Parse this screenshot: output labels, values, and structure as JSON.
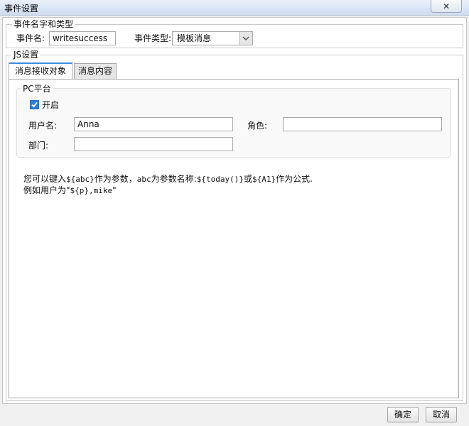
{
  "window": {
    "title": "事件设置",
    "close_glyph": "✕"
  },
  "event_group": {
    "legend": "事件名字和类型",
    "name_label": "事件名:",
    "name_value": "writesuccess",
    "type_label": "事件类型:",
    "type_value": "模板消息"
  },
  "js_group": {
    "legend": "JS设置"
  },
  "tabs": [
    {
      "label": "消息接收对象",
      "active": true
    },
    {
      "label": "消息内容",
      "active": false
    }
  ],
  "pc_platform": {
    "legend": "PC平台",
    "enable_label": "开启",
    "enable_checked": true,
    "username_label": "用户名:",
    "username_value": "Anna",
    "role_label": "角色:",
    "role_value": "",
    "dept_label": "部门:",
    "dept_value": ""
  },
  "hint": {
    "line1_a": "您可以键入",
    "line1_code1": "${abc}",
    "line1_b": "作为参数，",
    "line1_code2": "abc",
    "line1_c": "为参数名称:",
    "line1_code3": "${today()}",
    "line1_d": "或",
    "line1_code4": "${A1}",
    "line1_e": "作为公式.",
    "line2_a": "例如用户为\"",
    "line2_code": "${p},mike",
    "line2_b": "\""
  },
  "buttons": {
    "ok": "确定",
    "cancel": "取消"
  },
  "colors": {
    "accent": "#3c8be0",
    "checkbox": "#2a7fd9"
  }
}
